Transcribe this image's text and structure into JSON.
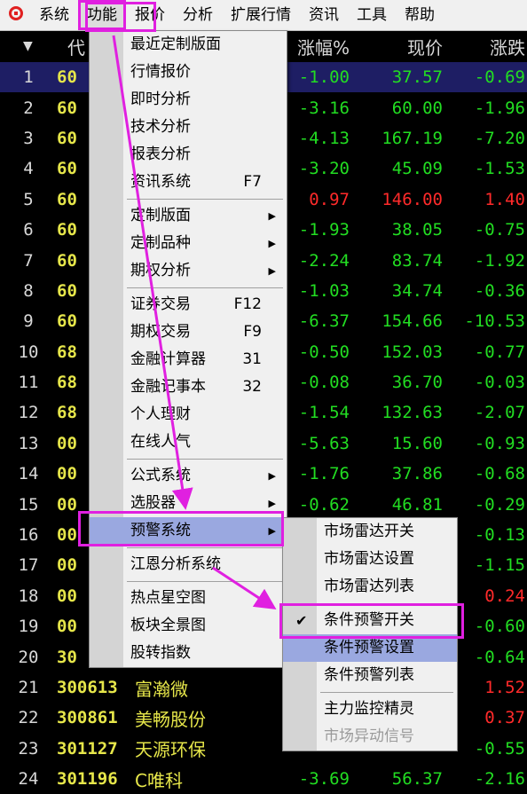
{
  "menubar": {
    "items": [
      "系统",
      "功能",
      "报价",
      "分析",
      "扩展行情",
      "资讯",
      "工具",
      "帮助"
    ]
  },
  "table": {
    "header": {
      "sort": "▼",
      "code": "代",
      "change_pct": "涨幅%",
      "price": "现价",
      "change": "涨跌"
    },
    "rows": [
      {
        "n": "1",
        "code": "60",
        "name": "",
        "pct": "-1.00",
        "price": "37.57",
        "chg": "-0.69",
        "color": "green"
      },
      {
        "n": "2",
        "code": "60",
        "name": "",
        "pct": "-3.16",
        "price": "60.00",
        "chg": "-1.96",
        "color": "green"
      },
      {
        "n": "3",
        "code": "60",
        "name": "",
        "pct": "-4.13",
        "price": "167.19",
        "chg": "-7.20",
        "color": "green"
      },
      {
        "n": "4",
        "code": "60",
        "name": "",
        "pct": "-3.20",
        "price": "45.09",
        "chg": "-1.53",
        "color": "green"
      },
      {
        "n": "5",
        "code": "60",
        "name": "",
        "pct": "0.97",
        "price": "146.00",
        "chg": "1.40",
        "color": "red"
      },
      {
        "n": "6",
        "code": "60",
        "name": "",
        "pct": "-1.93",
        "price": "38.05",
        "chg": "-0.75",
        "color": "green"
      },
      {
        "n": "7",
        "code": "60",
        "name": "",
        "pct": "-2.24",
        "price": "83.74",
        "chg": "-1.92",
        "color": "green"
      },
      {
        "n": "8",
        "code": "60",
        "name": "",
        "pct": "-1.03",
        "price": "34.74",
        "chg": "-0.36",
        "color": "green"
      },
      {
        "n": "9",
        "code": "60",
        "name": "",
        "pct": "-6.37",
        "price": "154.66",
        "chg": "-10.53",
        "color": "green"
      },
      {
        "n": "10",
        "code": "68",
        "name": "",
        "pct": "-0.50",
        "price": "152.03",
        "chg": "-0.77",
        "color": "green"
      },
      {
        "n": "11",
        "code": "68",
        "name": "",
        "pct": "-0.08",
        "price": "36.70",
        "chg": "-0.03",
        "color": "green"
      },
      {
        "n": "12",
        "code": "68",
        "name": "",
        "pct": "-1.54",
        "price": "132.63",
        "chg": "-2.07",
        "color": "green"
      },
      {
        "n": "13",
        "code": "00",
        "name": "",
        "pct": "-5.63",
        "price": "15.60",
        "chg": "-0.93",
        "color": "green"
      },
      {
        "n": "14",
        "code": "00",
        "name": "",
        "pct": "-1.76",
        "price": "37.86",
        "chg": "-0.68",
        "color": "green"
      },
      {
        "n": "15",
        "code": "00",
        "name": "",
        "pct": "-0.62",
        "price": "46.81",
        "chg": "-0.29",
        "color": "green"
      },
      {
        "n": "16",
        "code": "00",
        "name": "",
        "pct": "",
        "price": "",
        "chg": "-0.13",
        "color": "green"
      },
      {
        "n": "17",
        "code": "00",
        "name": "",
        "pct": "",
        "price": "",
        "chg": "-1.15",
        "color": "green"
      },
      {
        "n": "18",
        "code": "00",
        "name": "",
        "pct": "",
        "price": "",
        "chg": "0.24",
        "color": "red"
      },
      {
        "n": "19",
        "code": "00",
        "name": "",
        "pct": "",
        "price": "",
        "chg": "-0.60",
        "color": "green"
      },
      {
        "n": "20",
        "code": "30",
        "name": "",
        "pct": "",
        "price": "",
        "chg": "-0.64",
        "color": "green"
      },
      {
        "n": "21",
        "code": "300613",
        "name": "富瀚微",
        "pct": "",
        "price": "",
        "chg": "1.52",
        "color": "red"
      },
      {
        "n": "22",
        "code": "300861",
        "name": "美畅股份",
        "pct": "",
        "price": "",
        "chg": "0.37",
        "color": "red"
      },
      {
        "n": "23",
        "code": "301127",
        "name": "天源环保",
        "pct": "",
        "price": "",
        "chg": "-0.55",
        "color": "green"
      },
      {
        "n": "24",
        "code": "301196",
        "name": "C唯科",
        "pct": "-3.69",
        "price": "56.37",
        "chg": "-2.16",
        "color": "green"
      }
    ]
  },
  "function_menu": {
    "items": [
      {
        "label": "最近定制版面",
        "shortcut": "",
        "arrow": false
      },
      {
        "label": "行情报价",
        "shortcut": "",
        "arrow": false
      },
      {
        "label": "即时分析",
        "shortcut": "",
        "arrow": false
      },
      {
        "label": "技术分析",
        "shortcut": "",
        "arrow": false
      },
      {
        "label": "报表分析",
        "shortcut": "",
        "arrow": false
      },
      {
        "label": "资讯系统",
        "shortcut": "F7",
        "arrow": false
      },
      {
        "sep": true
      },
      {
        "label": "定制版面",
        "shortcut": "",
        "arrow": true
      },
      {
        "label": "定制品种",
        "shortcut": "",
        "arrow": true
      },
      {
        "label": "期权分析",
        "shortcut": "",
        "arrow": true
      },
      {
        "sep": true
      },
      {
        "label": "证券交易",
        "shortcut": "F12",
        "arrow": false
      },
      {
        "label": "期权交易",
        "shortcut": "F9",
        "arrow": false
      },
      {
        "label": "金融计算器",
        "shortcut": "31",
        "arrow": false
      },
      {
        "label": "金融记事本",
        "shortcut": "32",
        "arrow": false
      },
      {
        "label": "个人理财",
        "shortcut": "",
        "arrow": false
      },
      {
        "label": "在线人气",
        "shortcut": "",
        "arrow": false
      },
      {
        "sep": true
      },
      {
        "label": "公式系统",
        "shortcut": "",
        "arrow": true
      },
      {
        "label": "选股器",
        "shortcut": "",
        "arrow": true
      },
      {
        "label": "预警系统",
        "shortcut": "",
        "arrow": true,
        "highlight": true
      },
      {
        "sep": true
      },
      {
        "label": "江恩分析系统",
        "shortcut": "",
        "arrow": false
      },
      {
        "sep": true
      },
      {
        "label": "热点星空图",
        "shortcut": "",
        "arrow": false
      },
      {
        "label": "板块全景图",
        "shortcut": "",
        "arrow": false
      },
      {
        "label": "股转指数",
        "shortcut": "",
        "arrow": false
      }
    ]
  },
  "alert_submenu": {
    "items": [
      {
        "label": "市场雷达开关"
      },
      {
        "label": "市场雷达设置"
      },
      {
        "label": "市场雷达列表"
      },
      {
        "sep": true
      },
      {
        "label": "条件预警开关",
        "checked": true,
        "check_mark": "✔"
      },
      {
        "label": "条件预警设置",
        "highlight": true
      },
      {
        "label": "条件预警列表"
      },
      {
        "sep": true
      },
      {
        "label": "主力监控精灵"
      },
      {
        "label": "市场异动信号",
        "disabled": true
      }
    ]
  },
  "colors": {
    "up": "#ff2a2a",
    "down": "#22dd22",
    "code": "#e6e64a",
    "highlight_box": "#e020e0"
  }
}
